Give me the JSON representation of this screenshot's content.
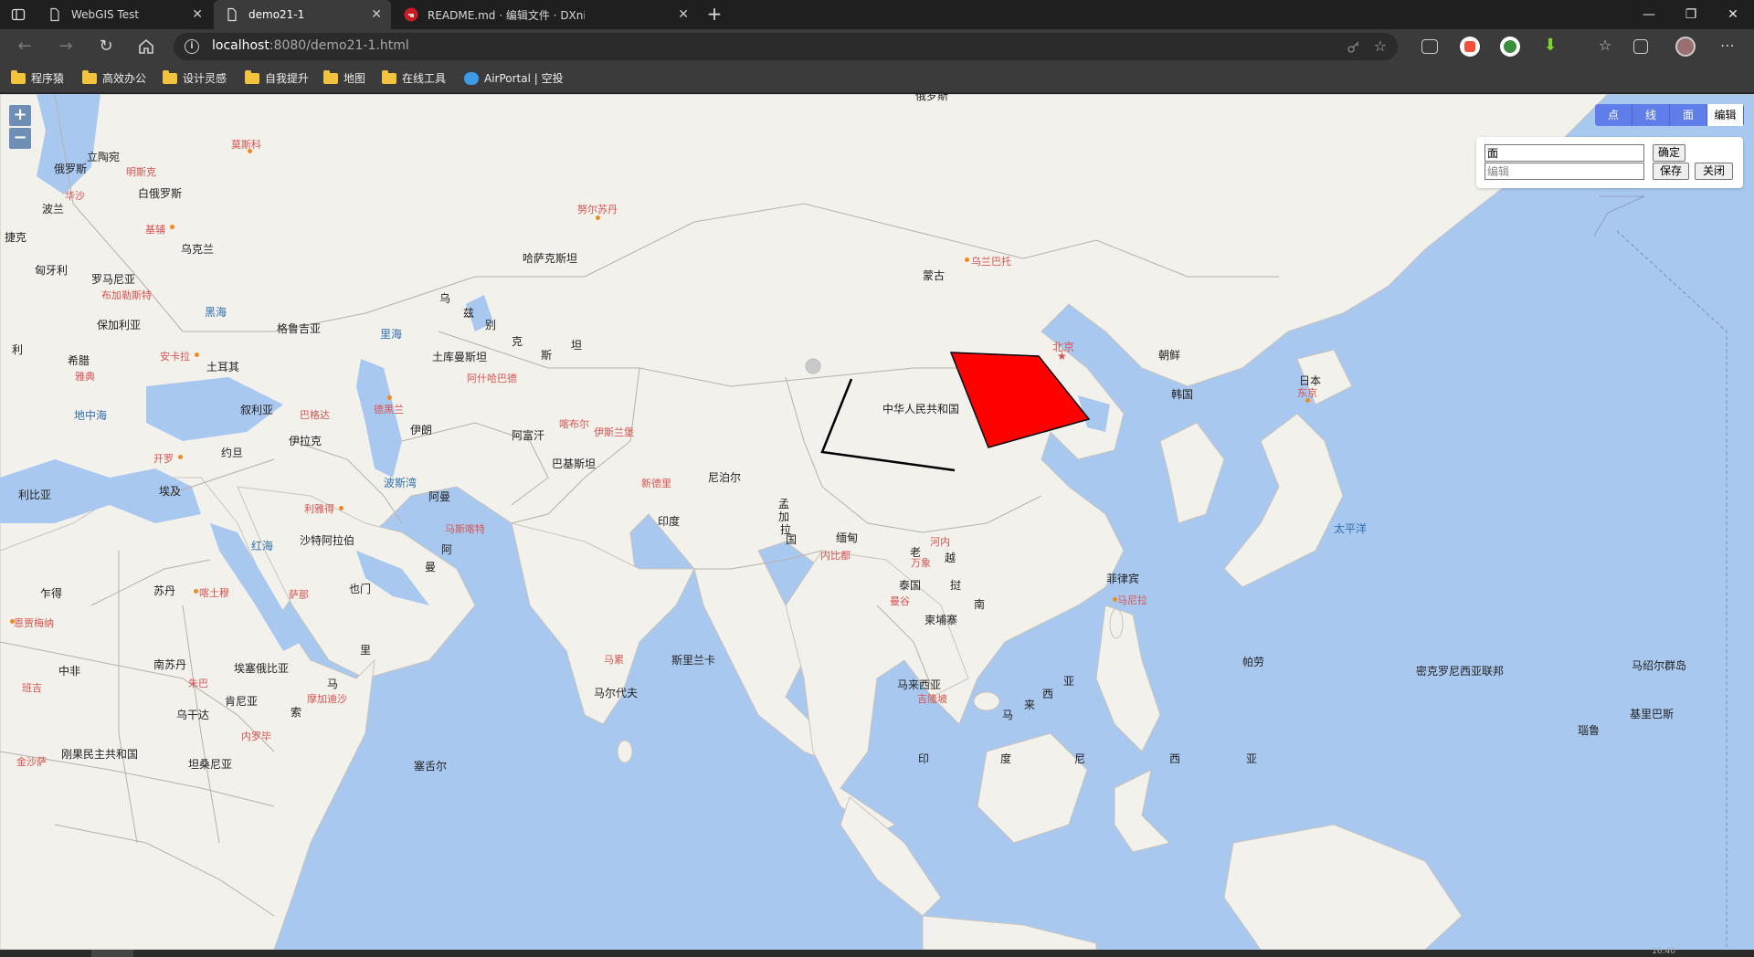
{
  "browser": {
    "tabs": [
      {
        "title": "WebGIS Test",
        "active": false
      },
      {
        "title": "demo21-1",
        "active": true
      },
      {
        "title": "README.md · 编辑文件 · DXnima",
        "active": false
      }
    ],
    "url_host": "localhost",
    "url_path": ":8080/demo21-1.html",
    "window_controls": {
      "minimize": "—",
      "maximize": "❐",
      "close": "✕"
    }
  },
  "bookmarks": [
    {
      "label": "程序猿",
      "icon": "folder-icon"
    },
    {
      "label": "高效办公",
      "icon": "folder-icon"
    },
    {
      "label": "设计灵感",
      "icon": "folder-icon"
    },
    {
      "label": "自我提升",
      "icon": "folder-icon"
    },
    {
      "label": "地图",
      "icon": "folder-icon"
    },
    {
      "label": "在线工具",
      "icon": "folder-icon"
    },
    {
      "label": "AirPortal | 空投",
      "icon": "cloud-icon"
    }
  ],
  "map": {
    "zoom_in": "+",
    "zoom_out": "−",
    "draw_tools": [
      "点",
      "线",
      "面",
      "编辑"
    ],
    "active_tool": "编辑",
    "edit_panel": {
      "type_value": "面",
      "edit_placeholder": "编辑",
      "confirm_label": "确定",
      "save_label": "保存",
      "close_label": "关闭"
    },
    "polygon_fill": "#ff0000",
    "line_color": "#000000",
    "labels": {
      "russia": "俄罗斯",
      "lithuania": "立陶宛",
      "moscow": "莫斯科",
      "russia_w": "俄罗斯",
      "minsk": "明斯克",
      "belarus": "白俄罗斯",
      "poland": "波兰",
      "warsaw": "华沙",
      "kyiv": "基辅",
      "ukraine": "乌克兰",
      "czech": "捷克",
      "hungary": "匈牙利",
      "romania": "罗马尼亚",
      "bucharest": "布加勒斯特",
      "bulgaria": "保加利亚",
      "black_sea": "黑海",
      "georgia": "格鲁吉亚",
      "caspian": "里海",
      "greece": "希腊",
      "ankara": "安卡拉",
      "turkey": "土耳其",
      "athens": "雅典",
      "mediterranean": "地中海",
      "syria": "叙利亚",
      "baghdad": "巴格达",
      "tehran": "德黑兰",
      "iran": "伊朗",
      "iraq": "伊拉克",
      "jordan": "约旦",
      "cairo": "开罗",
      "libya": "利比亚",
      "egypt": "埃及",
      "persian_gulf": "波斯湾",
      "oman": "阿曼",
      "riyadh": "利雅得",
      "muscat": "马斯喀特",
      "red_sea": "红海",
      "saudi": "沙特阿拉伯",
      "oman2a": "阿",
      "oman2b": "曼",
      "chad": "乍得",
      "sudan": "苏丹",
      "khartoum": "喀土穆",
      "sanaa": "萨那",
      "yemen": "也门",
      "ndjamena": "恩贾梅纳",
      "central_africa": "中非",
      "south_sudan": "南苏丹",
      "ethiopia": "埃塞俄比亚",
      "juba": "朱巴",
      "somalia_a": "马",
      "somalia_b": "里",
      "somalia_c": "索",
      "kenya": "肯尼亚",
      "mogadishu": "摩加迪沙",
      "uganda": "乌干达",
      "nairobi": "内罗毕",
      "dr_congo": "刚果民主共和国",
      "kinshasa": "金沙萨",
      "tanzania": "坦桑尼亚",
      "seychelles": "塞舌尔",
      "lebanon_frag": "利",
      "bangui": "班吉",
      "kazakhstan": "哈萨克斯坦",
      "astana": "努尔苏丹",
      "uzbek_a": "乌",
      "uzbek_b": "兹",
      "uzbek_c": "别",
      "uzbek_d": "克",
      "tajik_a": "斯",
      "tajik_b": "坦",
      "turkmenistan": "土库曼斯坦",
      "ashgabat": "阿什哈巴德",
      "kabul": "喀布尔",
      "afghanistan": "阿富汗",
      "islamabad": "伊斯兰堡",
      "pakistan": "巴基斯坦",
      "new_delhi": "新德里",
      "nepal": "尼泊尔",
      "india": "印度",
      "bangladesh_a": "孟",
      "bangladesh_b": "加",
      "bangladesh_c": "拉",
      "bangladesh_d": "国",
      "myanmar": "缅甸",
      "naypyidaw": "内比都",
      "laos_a": "老",
      "laos_b": "挝",
      "hanoi": "河内",
      "vientiane": "万象",
      "vietnam_a": "越",
      "vietnam_b": "南",
      "thailand": "泰国",
      "bangkok": "曼谷",
      "cambodia": "柬埔寨",
      "colombo": "马累",
      "sri_lanka": "斯里兰卡",
      "maldives": "马尔代夫",
      "mongolia": "蒙古",
      "ulaanbaatar": "乌兰巴托",
      "china": "中华人民共和国",
      "beijing": "北京",
      "north_korea": "朝鲜",
      "south_korea": "韩国",
      "japan": "日本",
      "tokyo": "东京",
      "pacific": "太平洋",
      "philippines": "菲律宾",
      "manila": "马尼拉",
      "malaysia": "马来西亚",
      "kuala_lumpur": "吉隆坡",
      "indonesia_a": "印",
      "indonesia_b": "度",
      "indonesia_c": "尼",
      "indonesia_d": "西",
      "indonesia_e": "亚",
      "ma_a": "马",
      "ma_b": "来",
      "ma_c": "西",
      "ma_d": "亚",
      "palau": "帕劳",
      "micronesia": "密克罗尼西亚联邦",
      "marshall": "马绍尔群岛",
      "kiribati": "基里巴斯",
      "nauru": "瑙鲁",
      "russia_far": "俄罗斯"
    }
  },
  "statusbar": {
    "time": "16:40"
  }
}
